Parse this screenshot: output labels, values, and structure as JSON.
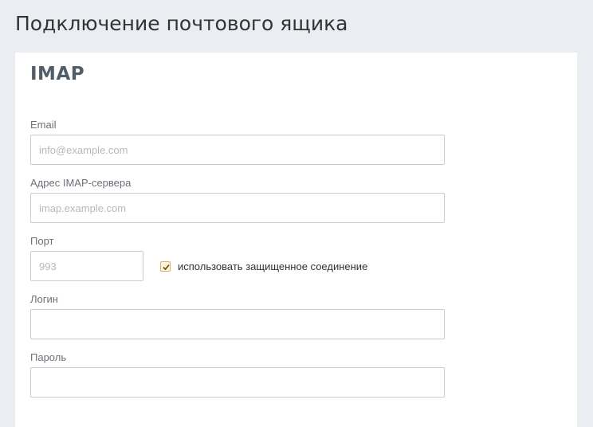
{
  "page": {
    "title": "Подключение почтового ящика"
  },
  "card": {
    "logo": "IMAP"
  },
  "form": {
    "email": {
      "label": "Email",
      "placeholder": "info@example.com",
      "value": ""
    },
    "server": {
      "label": "Адрес IMAP-сервера",
      "placeholder": "imap.example.com",
      "value": ""
    },
    "port": {
      "label": "Порт",
      "placeholder": "993",
      "value": ""
    },
    "ssl": {
      "label": "использовать защищенное соединение",
      "checked": true
    },
    "login": {
      "label": "Логин",
      "value": ""
    },
    "password": {
      "label": "Пароль",
      "value": ""
    }
  },
  "colors": {
    "background": "#eaeef2",
    "card": "#ffffff",
    "logo": "#535c69",
    "input_border": "#c6cdd3",
    "checkbox_fill": "#fdf3dc"
  },
  "icons": {
    "ssl_checkbox": "checkmark-icon"
  }
}
